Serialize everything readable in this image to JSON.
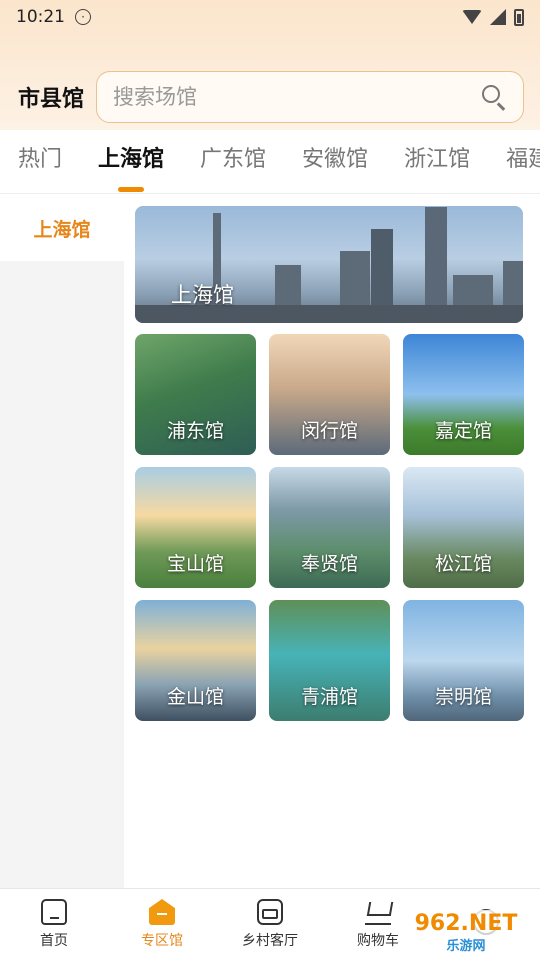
{
  "status_bar": {
    "time": "10:21"
  },
  "header": {
    "title": "市县馆",
    "search_placeholder": "搜索场馆"
  },
  "tabs": [
    {
      "label": "热门"
    },
    {
      "label": "上海馆",
      "active": true
    },
    {
      "label": "广东馆"
    },
    {
      "label": "安徽馆"
    },
    {
      "label": "浙江馆"
    },
    {
      "label": "福建"
    }
  ],
  "sidebar": {
    "items": [
      {
        "label": "上海馆",
        "active": true
      }
    ]
  },
  "banner": {
    "label": "上海馆"
  },
  "venues": [
    {
      "label": "浦东馆"
    },
    {
      "label": "闵行馆"
    },
    {
      "label": "嘉定馆"
    },
    {
      "label": "宝山馆"
    },
    {
      "label": "奉贤馆"
    },
    {
      "label": "松江馆"
    },
    {
      "label": "金山馆"
    },
    {
      "label": "青浦馆"
    },
    {
      "label": "崇明馆"
    }
  ],
  "bottom_nav": [
    {
      "label": "首页",
      "icon": "home-icon"
    },
    {
      "label": "专区馆",
      "icon": "zone-icon",
      "active": true
    },
    {
      "label": "乡村客厅",
      "icon": "sofa-icon"
    },
    {
      "label": "购物车",
      "icon": "cart-icon"
    },
    {
      "label": "",
      "icon": "profile-icon"
    }
  ],
  "watermark": {
    "line1": "962.NET",
    "line2": "乐游网"
  },
  "colors": {
    "accent": "#f08a00",
    "sidebar_active": "#e6871b"
  }
}
